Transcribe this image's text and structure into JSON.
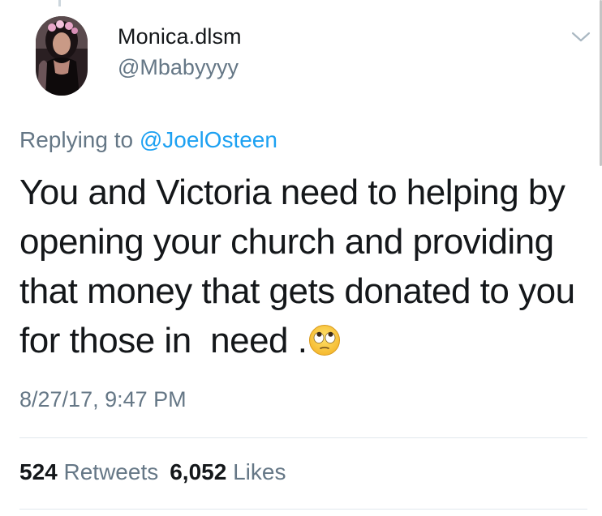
{
  "tweet": {
    "author": {
      "display_name": "Monica.dlsm",
      "handle": "@Mbabyyyy",
      "avatar_icon": "profile-photo"
    },
    "replying_prefix": "Replying to ",
    "replying_to": "@JoelOsteen",
    "text_lines": [
      "You and Victoria need to helping by",
      "opening your church and providing",
      "that money that gets donated to you",
      "for those in  need ."
    ],
    "emoji": "face-with-rolling-eyes",
    "timestamp": "8/27/17, 9:47 PM",
    "stats": {
      "retweets_count": "524",
      "retweets_label": "Retweets",
      "likes_count": "6,052",
      "likes_label": "Likes"
    }
  },
  "colors": {
    "primary_text": "#14171a",
    "secondary_text": "#657786",
    "link": "#1da1f2",
    "divider": "#e1e8ed"
  },
  "icons": {
    "menu": "chevron-down-icon"
  }
}
